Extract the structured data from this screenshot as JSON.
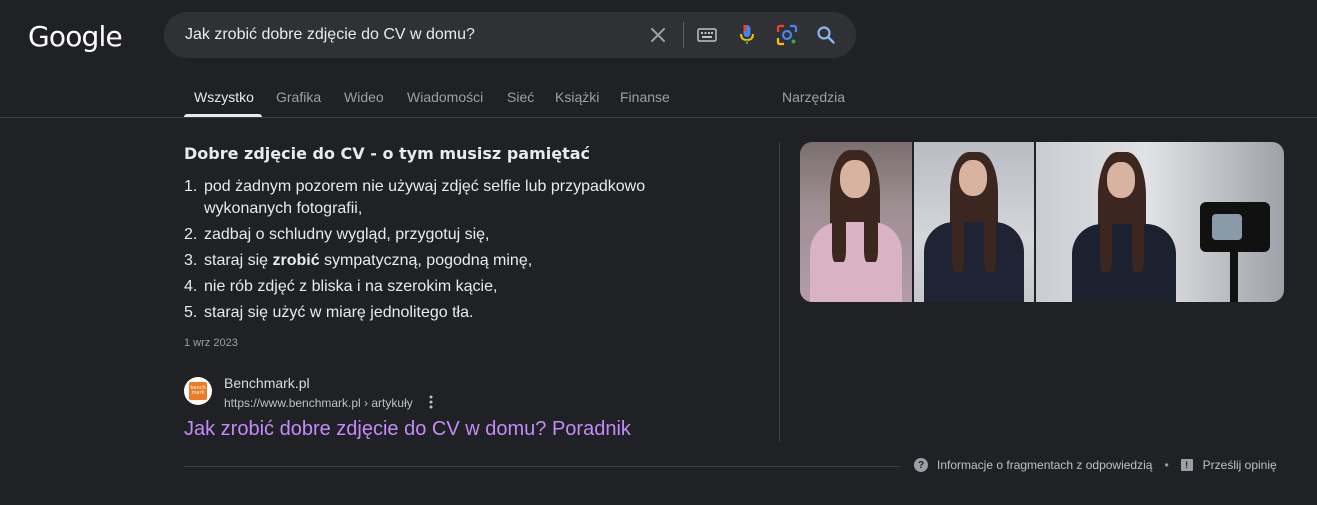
{
  "logo": "Google",
  "search": {
    "value": "Jak zrobić dobre zdjęcie do CV w domu?",
    "icons": [
      "close-icon",
      "keyboard-icon",
      "microphone-icon",
      "lens-icon",
      "search-icon"
    ]
  },
  "tabs": [
    {
      "label": "Wszystko",
      "active": true
    },
    {
      "label": "Grafika"
    },
    {
      "label": "Wideo"
    },
    {
      "label": "Wiadomości"
    },
    {
      "label": "Sieć"
    },
    {
      "label": "Książki"
    },
    {
      "label": "Finanse"
    }
  ],
  "tools_label": "Narzędzia",
  "snippet": {
    "title": "Dobre zdjęcie do CV - o tym musisz pamiętać",
    "steps": [
      {
        "num": "1.",
        "text": "pod żadnym pozorem nie używaj zdjęć selfie lub przypadkowo wykonanych fotografii,"
      },
      {
        "num": "2.",
        "text": "zadbaj o schludny wygląd, przygotuj się,"
      },
      {
        "num": "3.",
        "pre": "staraj się ",
        "bold": "zrobić",
        "post": " sympatyczną, pogodną minę,"
      },
      {
        "num": "4.",
        "text": "nie rób zdjęć z bliska i na szerokim kącie,"
      },
      {
        "num": "5.",
        "text": "staraj się użyć w miarę jednolitego tła."
      }
    ],
    "date": "1 wrz 2023"
  },
  "source": {
    "favicon_text": "bench mark",
    "site_name": "Benchmark.pl",
    "url": "https://www.benchmark.pl › artykuły",
    "link_title": "Jak zrobić dobre zdjęcie do CV w domu? Poradnik"
  },
  "footer": {
    "info": "Informacje o fragmentach z odpowiedzią",
    "separator": "•",
    "feedback": "Prześlij opinię"
  },
  "colors": {
    "background": "#202124",
    "link_visited": "#c58af9",
    "search_bg": "#303134"
  }
}
